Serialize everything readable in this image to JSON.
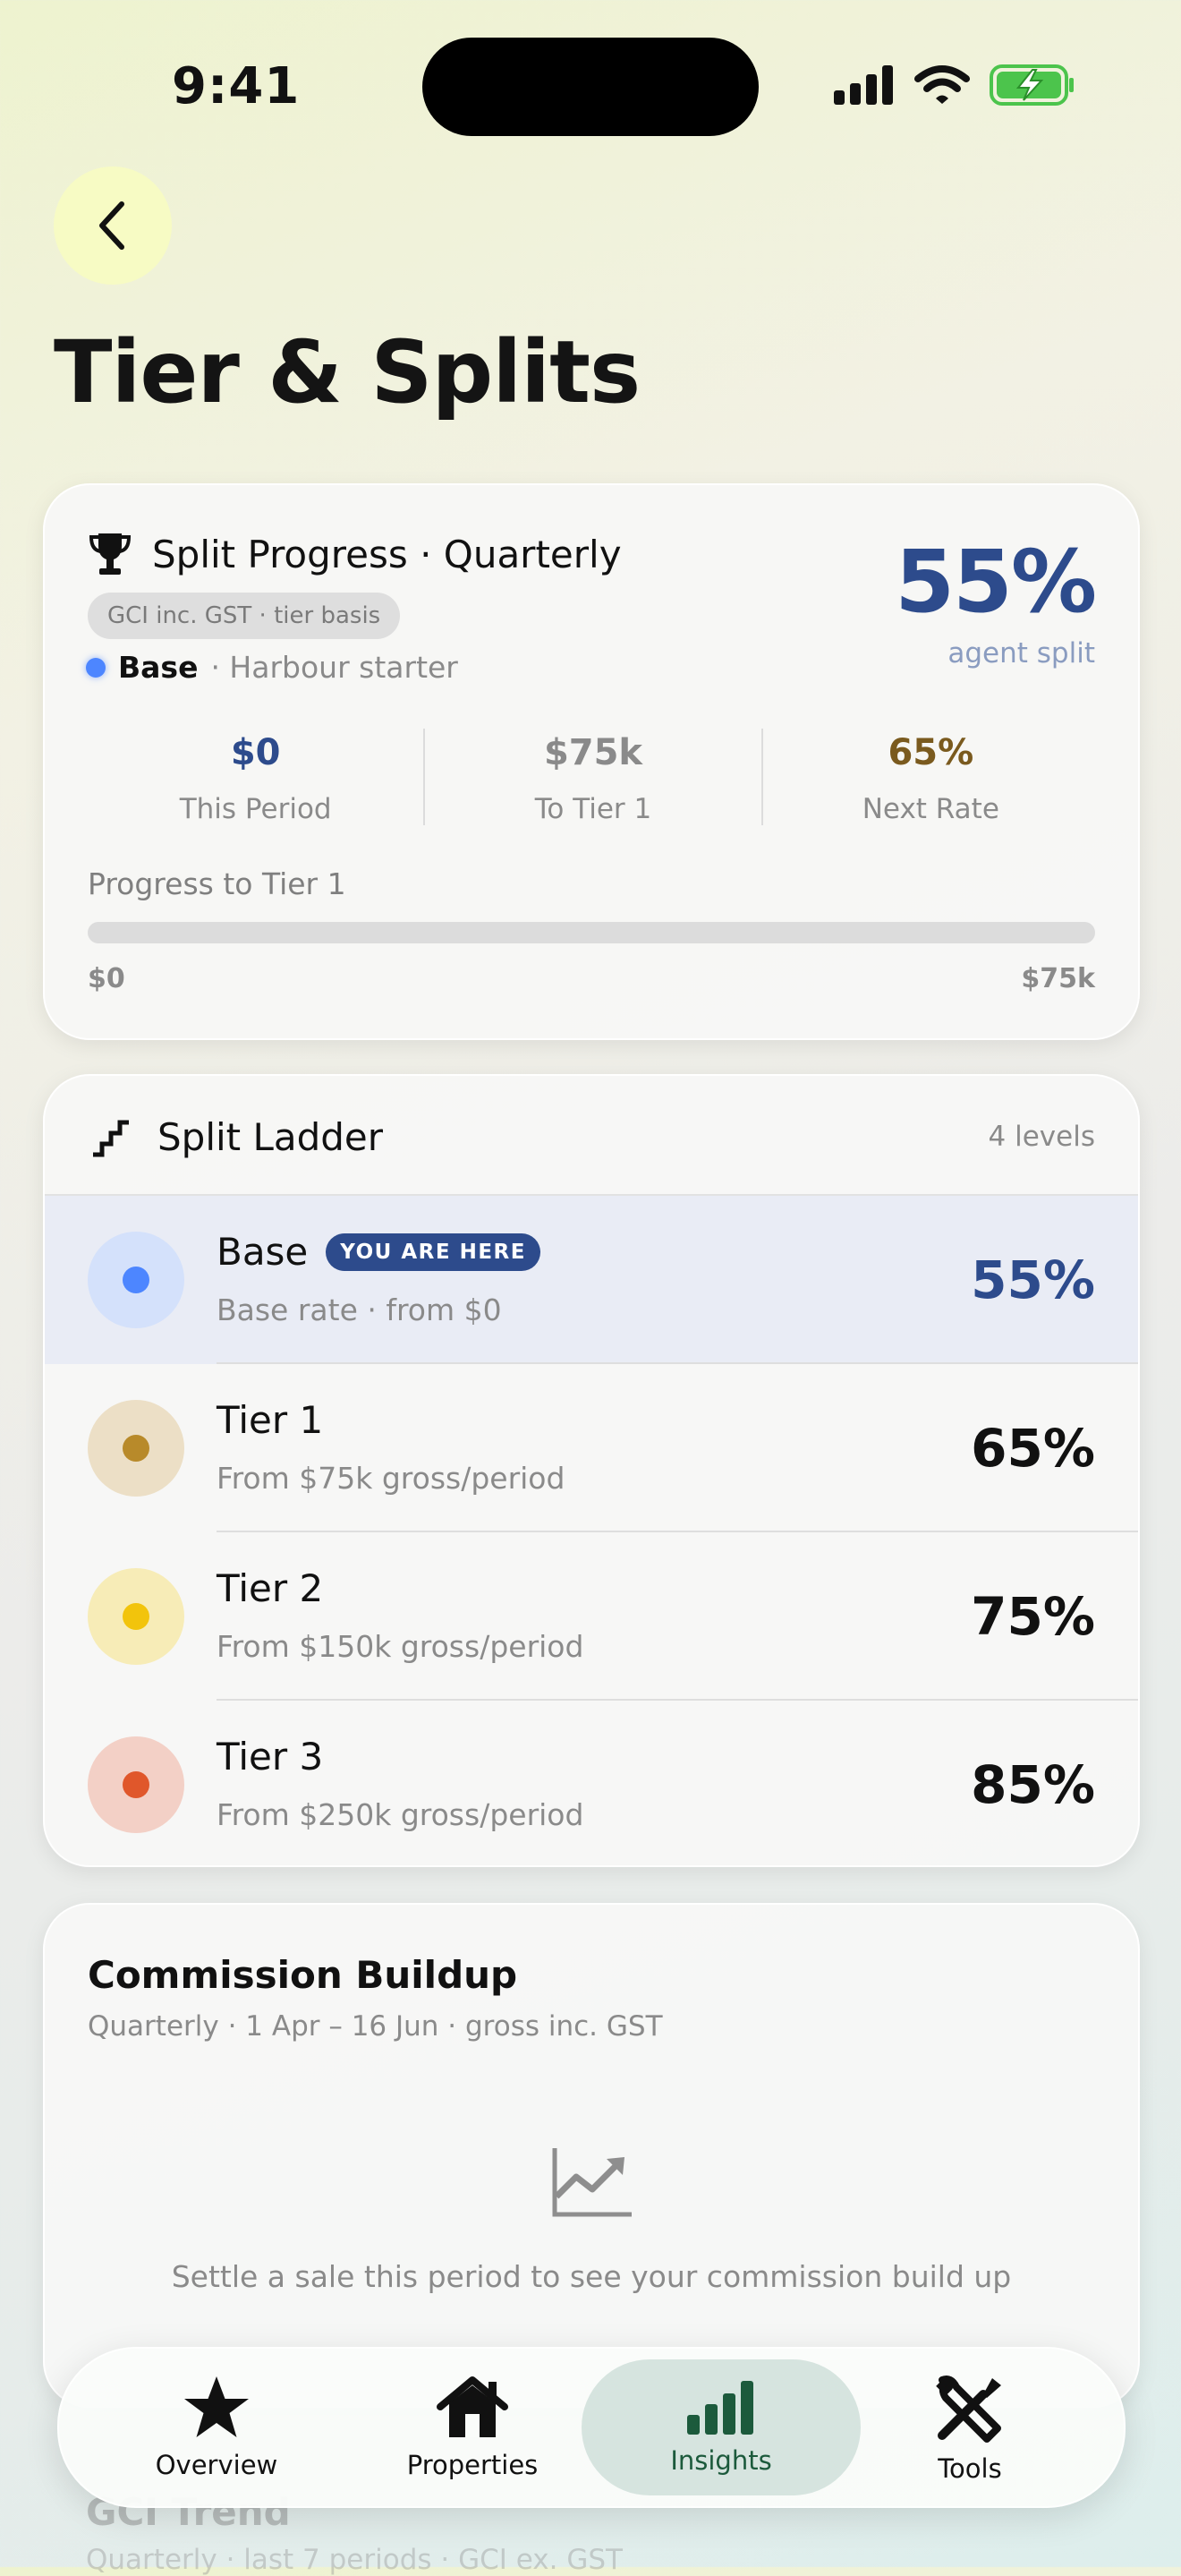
{
  "status_bar": {
    "time": "9:41"
  },
  "header": {
    "title": "Tier & Splits"
  },
  "progress": {
    "title": "Split Progress · Quarterly",
    "basis": "GCI inc. GST · tier basis",
    "tier_name": "Base",
    "tier_sub": "· Harbour starter",
    "agent_split": "55%",
    "agent_split_label": "agent split",
    "stats": [
      {
        "value": "$0",
        "label": "This Period",
        "color": "#2d4b8c"
      },
      {
        "value": "$75k",
        "label": "To Tier 1",
        "color": "#8a8a8a"
      },
      {
        "value": "65%",
        "label": "Next Rate",
        "color": "#7a5a1e"
      }
    ],
    "bar_label": "Progress to Tier 1",
    "bar_min": "$0",
    "bar_max": "$75k",
    "bar_fraction": 0
  },
  "ladder": {
    "title": "Split Ladder",
    "count": "4 levels",
    "current_badge": "YOU ARE HERE",
    "tiers": [
      {
        "name": "Base",
        "desc": "Base rate · from $0",
        "pct": "55%",
        "dot": "#4d86ff",
        "bg": "#d4e1fb",
        "pct_color": "#2d4b8c",
        "current": true
      },
      {
        "name": "Tier 1",
        "desc": "From $75k gross/period",
        "pct": "65%",
        "dot": "#b88a2a",
        "bg": "#ecdfc6",
        "pct_color": "#111111",
        "current": false
      },
      {
        "name": "Tier 2",
        "desc": "From $150k gross/period",
        "pct": "75%",
        "dot": "#f2c40c",
        "bg": "#f7ecb7",
        "pct_color": "#111111",
        "current": false
      },
      {
        "name": "Tier 3",
        "desc": "From $250k gross/period",
        "pct": "85%",
        "dot": "#e0572b",
        "bg": "#f3d0c6",
        "pct_color": "#111111",
        "current": false
      }
    ]
  },
  "commission": {
    "title": "Commission Buildup",
    "subtitle": "Quarterly · 1 Apr – 16 Jun · gross inc. GST",
    "empty_text": "Settle a sale this period to see your commission build up"
  },
  "gci_trend": {
    "title": "GCI Trend",
    "subtitle": "Quarterly · last 7 periods · GCI ex. GST"
  },
  "tabs": [
    {
      "label": "Overview",
      "icon": "star-icon",
      "active": false
    },
    {
      "label": "Properties",
      "icon": "house-icon",
      "active": false
    },
    {
      "label": "Insights",
      "icon": "bar-chart-icon",
      "active": true
    },
    {
      "label": "Tools",
      "icon": "wrench-screwdriver-icon",
      "active": false
    }
  ]
}
